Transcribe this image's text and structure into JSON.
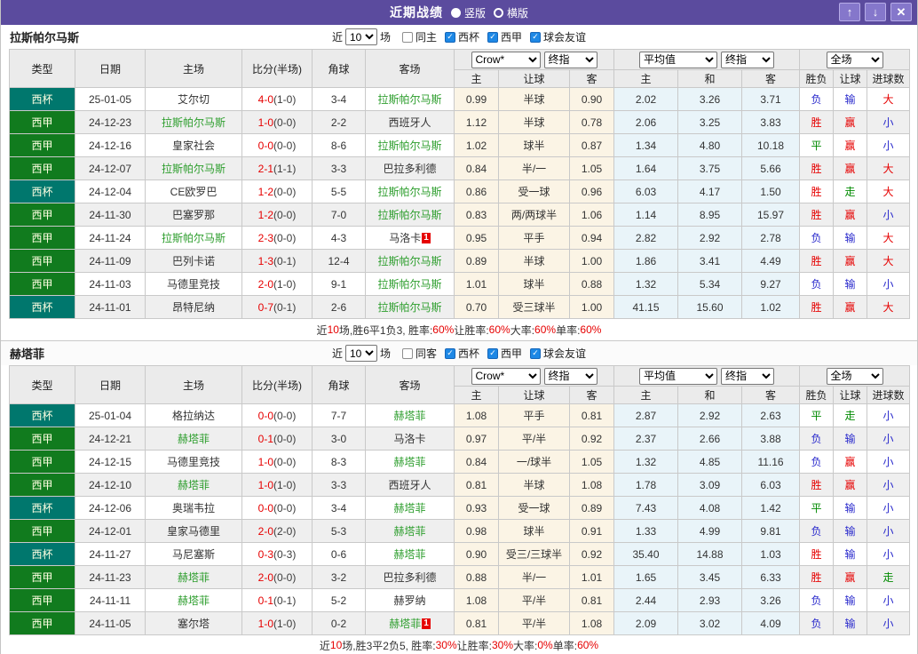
{
  "titlebar": {
    "title": "近期战绩",
    "radio_vertical": "竖版",
    "radio_horizontal": "横版"
  },
  "icons": {
    "up": "↑",
    "down": "↓",
    "close": "✕",
    "check": "✓"
  },
  "filter": {
    "near": "近",
    "count": "10",
    "matches": "场",
    "cup": "西杯",
    "league": "西甲",
    "friendly": "球会友谊"
  },
  "header": {
    "type": "类型",
    "date": "日期",
    "home": "主场",
    "score": "比分(半场)",
    "corner": "角球",
    "away": "客场",
    "dd_crow": "Crow*",
    "dd_final": "终指",
    "dd_avg": "平均值",
    "dd_full": "全场",
    "sub_home": "主",
    "sub_handicap": "让球",
    "sub_away": "客",
    "sub_avg_home": "主",
    "sub_avg_draw": "和",
    "sub_avg_away": "客",
    "sub_result": "胜负",
    "sub_let": "让球",
    "sub_goals": "进球数"
  },
  "colors": {
    "titlebar": "#5b4b9e",
    "cup_badge": "#00776d",
    "league_badge": "#117b1e",
    "team_green": "#2e9e2e",
    "win_red": "#e60000",
    "lose_blue": "#2929cc",
    "draw_green": "#008a00",
    "crow_bg": "#fbf4e5",
    "avg_bg": "#e9f4f9",
    "checked_blue": "#1e88e5"
  },
  "tables": [
    {
      "team": "拉斯帕尔马斯",
      "same_label": "同主",
      "rows": [
        {
          "type": "西杯",
          "tclass": "cup",
          "date": "25-01-05",
          "home": "艾尔切",
          "home_green": false,
          "home_badge": "",
          "score": "4-0",
          "half": "(1-0)",
          "corner": "3-4",
          "away": "拉斯帕尔马斯",
          "away_green": true,
          "away_badge": "",
          "o1": "0.99",
          "handicap": "半球",
          "o2": "0.90",
          "a1": "2.02",
          "a2": "3.26",
          "a3": "3.71",
          "r1": "负",
          "r1c": "blue",
          "r2": "输",
          "r2c": "blue",
          "r3": "大",
          "r3c": "red"
        },
        {
          "type": "西甲",
          "tclass": "league",
          "date": "24-12-23",
          "home": "拉斯帕尔马斯",
          "home_green": true,
          "home_badge": "",
          "score": "1-0",
          "half": "(0-0)",
          "corner": "2-2",
          "away": "西班牙人",
          "away_green": false,
          "away_badge": "",
          "o1": "1.12",
          "handicap": "半球",
          "o2": "0.78",
          "a1": "2.06",
          "a2": "3.25",
          "a3": "3.83",
          "r1": "胜",
          "r1c": "red",
          "r2": "赢",
          "r2c": "red",
          "r3": "小",
          "r3c": "blue"
        },
        {
          "type": "西甲",
          "tclass": "league",
          "date": "24-12-16",
          "home": "皇家社会",
          "home_green": false,
          "home_badge": "",
          "score": "0-0",
          "half": "(0-0)",
          "corner": "8-6",
          "away": "拉斯帕尔马斯",
          "away_green": true,
          "away_badge": "",
          "o1": "1.02",
          "handicap": "球半",
          "o2": "0.87",
          "a1": "1.34",
          "a2": "4.80",
          "a3": "10.18",
          "r1": "平",
          "r1c": "green",
          "r2": "赢",
          "r2c": "red",
          "r3": "小",
          "r3c": "blue"
        },
        {
          "type": "西甲",
          "tclass": "league",
          "date": "24-12-07",
          "home": "拉斯帕尔马斯",
          "home_green": true,
          "home_badge": "",
          "score": "2-1",
          "half": "(1-1)",
          "corner": "3-3",
          "away": "巴拉多利德",
          "away_green": false,
          "away_badge": "",
          "o1": "0.84",
          "handicap": "半/一",
          "o2": "1.05",
          "a1": "1.64",
          "a2": "3.75",
          "a3": "5.66",
          "r1": "胜",
          "r1c": "red",
          "r2": "赢",
          "r2c": "red",
          "r3": "大",
          "r3c": "red"
        },
        {
          "type": "西杯",
          "tclass": "cup",
          "date": "24-12-04",
          "home": "CE欧罗巴",
          "home_green": false,
          "home_badge": "",
          "score": "1-2",
          "half": "(0-0)",
          "corner": "5-5",
          "away": "拉斯帕尔马斯",
          "away_green": true,
          "away_badge": "",
          "o1": "0.86",
          "handicap": "受一球",
          "o2": "0.96",
          "a1": "6.03",
          "a2": "4.17",
          "a3": "1.50",
          "r1": "胜",
          "r1c": "red",
          "r2": "走",
          "r2c": "green",
          "r3": "大",
          "r3c": "red"
        },
        {
          "type": "西甲",
          "tclass": "league",
          "date": "24-11-30",
          "home": "巴塞罗那",
          "home_green": false,
          "home_badge": "",
          "score": "1-2",
          "half": "(0-0)",
          "corner": "7-0",
          "away": "拉斯帕尔马斯",
          "away_green": true,
          "away_badge": "",
          "o1": "0.83",
          "handicap": "两/两球半",
          "o2": "1.06",
          "a1": "1.14",
          "a2": "8.95",
          "a3": "15.97",
          "r1": "胜",
          "r1c": "red",
          "r2": "赢",
          "r2c": "red",
          "r3": "小",
          "r3c": "blue"
        },
        {
          "type": "西甲",
          "tclass": "league",
          "date": "24-11-24",
          "home": "拉斯帕尔马斯",
          "home_green": true,
          "home_badge": "",
          "score": "2-3",
          "half": "(0-0)",
          "corner": "4-3",
          "away": "马洛卡",
          "away_green": false,
          "away_badge": "1",
          "o1": "0.95",
          "handicap": "平手",
          "o2": "0.94",
          "a1": "2.82",
          "a2": "2.92",
          "a3": "2.78",
          "r1": "负",
          "r1c": "blue",
          "r2": "输",
          "r2c": "blue",
          "r3": "大",
          "r3c": "red"
        },
        {
          "type": "西甲",
          "tclass": "league",
          "date": "24-11-09",
          "home": "巴列卡诺",
          "home_green": false,
          "home_badge": "",
          "score": "1-3",
          "half": "(0-1)",
          "corner": "12-4",
          "away": "拉斯帕尔马斯",
          "away_green": true,
          "away_badge": "",
          "o1": "0.89",
          "handicap": "半球",
          "o2": "1.00",
          "a1": "1.86",
          "a2": "3.41",
          "a3": "4.49",
          "r1": "胜",
          "r1c": "red",
          "r2": "赢",
          "r2c": "red",
          "r3": "大",
          "r3c": "red"
        },
        {
          "type": "西甲",
          "tclass": "league",
          "date": "24-11-03",
          "home": "马德里竞技",
          "home_green": false,
          "home_badge": "",
          "score": "2-0",
          "half": "(1-0)",
          "corner": "9-1",
          "away": "拉斯帕尔马斯",
          "away_green": true,
          "away_badge": "",
          "o1": "1.01",
          "handicap": "球半",
          "o2": "0.88",
          "a1": "1.32",
          "a2": "5.34",
          "a3": "9.27",
          "r1": "负",
          "r1c": "blue",
          "r2": "输",
          "r2c": "blue",
          "r3": "小",
          "r3c": "blue"
        },
        {
          "type": "西杯",
          "tclass": "cup",
          "date": "24-11-01",
          "home": "昂特尼纳",
          "home_green": false,
          "home_badge": "",
          "score": "0-7",
          "half": "(0-1)",
          "corner": "2-6",
          "away": "拉斯帕尔马斯",
          "away_green": true,
          "away_badge": "",
          "o1": "0.70",
          "handicap": "受三球半",
          "o2": "1.00",
          "a1": "41.15",
          "a2": "15.60",
          "a3": "1.02",
          "r1": "胜",
          "r1c": "red",
          "r2": "赢",
          "r2c": "red",
          "r3": "大",
          "r3c": "red"
        }
      ],
      "summary": [
        {
          "t": "近"
        },
        {
          "t": "10",
          "r": true
        },
        {
          "t": "场,胜6平1负3, 胜率:"
        },
        {
          "t": "60%",
          "r": true
        },
        {
          "t": " 让胜率:"
        },
        {
          "t": "60%",
          "r": true
        },
        {
          "t": " 大率:"
        },
        {
          "t": "60%",
          "r": true
        },
        {
          "t": " 单率:"
        },
        {
          "t": "60%",
          "r": true
        }
      ]
    },
    {
      "team": "赫塔菲",
      "same_label": "同客",
      "rows": [
        {
          "type": "西杯",
          "tclass": "cup",
          "date": "25-01-04",
          "home": "格拉纳达",
          "home_green": false,
          "home_badge": "",
          "score": "0-0",
          "half": "(0-0)",
          "corner": "7-7",
          "away": "赫塔菲",
          "away_green": true,
          "away_badge": "",
          "o1": "1.08",
          "handicap": "平手",
          "o2": "0.81",
          "a1": "2.87",
          "a2": "2.92",
          "a3": "2.63",
          "r1": "平",
          "r1c": "green",
          "r2": "走",
          "r2c": "green",
          "r3": "小",
          "r3c": "blue"
        },
        {
          "type": "西甲",
          "tclass": "league",
          "date": "24-12-21",
          "home": "赫塔菲",
          "home_green": true,
          "home_badge": "",
          "score": "0-1",
          "half": "(0-0)",
          "corner": "3-0",
          "away": "马洛卡",
          "away_green": false,
          "away_badge": "",
          "o1": "0.97",
          "handicap": "平/半",
          "o2": "0.92",
          "a1": "2.37",
          "a2": "2.66",
          "a3": "3.88",
          "r1": "负",
          "r1c": "blue",
          "r2": "输",
          "r2c": "blue",
          "r3": "小",
          "r3c": "blue"
        },
        {
          "type": "西甲",
          "tclass": "league",
          "date": "24-12-15",
          "home": "马德里竞技",
          "home_green": false,
          "home_badge": "",
          "score": "1-0",
          "half": "(0-0)",
          "corner": "8-3",
          "away": "赫塔菲",
          "away_green": true,
          "away_badge": "",
          "o1": "0.84",
          "handicap": "一/球半",
          "o2": "1.05",
          "a1": "1.32",
          "a2": "4.85",
          "a3": "11.16",
          "r1": "负",
          "r1c": "blue",
          "r2": "赢",
          "r2c": "red",
          "r3": "小",
          "r3c": "blue"
        },
        {
          "type": "西甲",
          "tclass": "league",
          "date": "24-12-10",
          "home": "赫塔菲",
          "home_green": true,
          "home_badge": "",
          "score": "1-0",
          "half": "(1-0)",
          "corner": "3-3",
          "away": "西班牙人",
          "away_green": false,
          "away_badge": "",
          "o1": "0.81",
          "handicap": "半球",
          "o2": "1.08",
          "a1": "1.78",
          "a2": "3.09",
          "a3": "6.03",
          "r1": "胜",
          "r1c": "red",
          "r2": "赢",
          "r2c": "red",
          "r3": "小",
          "r3c": "blue"
        },
        {
          "type": "西杯",
          "tclass": "cup",
          "date": "24-12-06",
          "home": "奥瑞韦拉",
          "home_green": false,
          "home_badge": "",
          "score": "0-0",
          "half": "(0-0)",
          "corner": "3-4",
          "away": "赫塔菲",
          "away_green": true,
          "away_badge": "",
          "o1": "0.93",
          "handicap": "受一球",
          "o2": "0.89",
          "a1": "7.43",
          "a2": "4.08",
          "a3": "1.42",
          "r1": "平",
          "r1c": "green",
          "r2": "输",
          "r2c": "blue",
          "r3": "小",
          "r3c": "blue"
        },
        {
          "type": "西甲",
          "tclass": "league",
          "date": "24-12-01",
          "home": "皇家马德里",
          "home_green": false,
          "home_badge": "",
          "score": "2-0",
          "half": "(2-0)",
          "corner": "5-3",
          "away": "赫塔菲",
          "away_green": true,
          "away_badge": "",
          "o1": "0.98",
          "handicap": "球半",
          "o2": "0.91",
          "a1": "1.33",
          "a2": "4.99",
          "a3": "9.81",
          "r1": "负",
          "r1c": "blue",
          "r2": "输",
          "r2c": "blue",
          "r3": "小",
          "r3c": "blue"
        },
        {
          "type": "西杯",
          "tclass": "cup",
          "date": "24-11-27",
          "home": "马尼塞斯",
          "home_green": false,
          "home_badge": "",
          "score": "0-3",
          "half": "(0-3)",
          "corner": "0-6",
          "away": "赫塔菲",
          "away_green": true,
          "away_badge": "",
          "o1": "0.90",
          "handicap": "受三/三球半",
          "o2": "0.92",
          "a1": "35.40",
          "a2": "14.88",
          "a3": "1.03",
          "r1": "胜",
          "r1c": "red",
          "r2": "输",
          "r2c": "blue",
          "r3": "小",
          "r3c": "blue"
        },
        {
          "type": "西甲",
          "tclass": "league",
          "date": "24-11-23",
          "home": "赫塔菲",
          "home_green": true,
          "home_badge": "",
          "score": "2-0",
          "half": "(0-0)",
          "corner": "3-2",
          "away": "巴拉多利德",
          "away_green": false,
          "away_badge": "",
          "o1": "0.88",
          "handicap": "半/一",
          "o2": "1.01",
          "a1": "1.65",
          "a2": "3.45",
          "a3": "6.33",
          "r1": "胜",
          "r1c": "red",
          "r2": "赢",
          "r2c": "red",
          "r3": "走",
          "r3c": "green"
        },
        {
          "type": "西甲",
          "tclass": "league",
          "date": "24-11-11",
          "home": "赫塔菲",
          "home_green": true,
          "home_badge": "",
          "score": "0-1",
          "half": "(0-1)",
          "corner": "5-2",
          "away": "赫罗纳",
          "away_green": false,
          "away_badge": "",
          "o1": "1.08",
          "handicap": "平/半",
          "o2": "0.81",
          "a1": "2.44",
          "a2": "2.93",
          "a3": "3.26",
          "r1": "负",
          "r1c": "blue",
          "r2": "输",
          "r2c": "blue",
          "r3": "小",
          "r3c": "blue"
        },
        {
          "type": "西甲",
          "tclass": "league",
          "date": "24-11-05",
          "home": "塞尔塔",
          "home_green": false,
          "home_badge": "",
          "score": "1-0",
          "half": "(1-0)",
          "corner": "0-2",
          "away": "赫塔菲",
          "away_green": true,
          "away_badge": "1",
          "o1": "0.81",
          "handicap": "平/半",
          "o2": "1.08",
          "a1": "2.09",
          "a2": "3.02",
          "a3": "4.09",
          "r1": "负",
          "r1c": "blue",
          "r2": "输",
          "r2c": "blue",
          "r3": "小",
          "r3c": "blue"
        }
      ],
      "summary": [
        {
          "t": "近"
        },
        {
          "t": "10",
          "r": true
        },
        {
          "t": "场,胜3平2负5, 胜率:"
        },
        {
          "t": "30%",
          "r": true
        },
        {
          "t": " 让胜率:"
        },
        {
          "t": "30%",
          "r": true
        },
        {
          "t": " 大率:"
        },
        {
          "t": "0%",
          "r": true
        },
        {
          "t": " 单率:"
        },
        {
          "t": "60%",
          "r": true
        }
      ]
    }
  ]
}
